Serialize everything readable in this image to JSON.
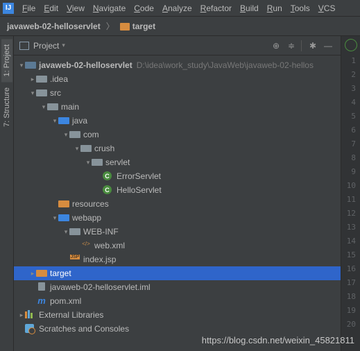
{
  "menu": {
    "items": [
      "File",
      "Edit",
      "View",
      "Navigate",
      "Code",
      "Analyze",
      "Refactor",
      "Build",
      "Run",
      "Tools",
      "VCS"
    ]
  },
  "breadcrumb": {
    "project": "javaweb-02-helloservlet",
    "target": "target"
  },
  "panel": {
    "title": "Project"
  },
  "sidebar": {
    "tabs": [
      {
        "label": "1: Project",
        "active": true
      },
      {
        "label": "7: Structure",
        "active": false
      }
    ]
  },
  "tree": [
    {
      "depth": 0,
      "arrow": "down",
      "icon": "folder-gblue",
      "label": "javaweb-02-helloservlet",
      "bold": true,
      "path": "D:\\idea\\work_study\\JavaWeb\\javaweb-02-hellos"
    },
    {
      "depth": 1,
      "arrow": "right",
      "icon": "folder",
      "label": ".idea"
    },
    {
      "depth": 1,
      "arrow": "down",
      "icon": "folder",
      "label": "src"
    },
    {
      "depth": 2,
      "arrow": "down",
      "icon": "folder",
      "label": "main"
    },
    {
      "depth": 3,
      "arrow": "down",
      "icon": "folder-blue",
      "label": "java"
    },
    {
      "depth": 4,
      "arrow": "down",
      "icon": "folder",
      "label": "com"
    },
    {
      "depth": 5,
      "arrow": "down",
      "icon": "folder",
      "label": "crush"
    },
    {
      "depth": 6,
      "arrow": "down",
      "icon": "folder",
      "label": "servlet"
    },
    {
      "depth": 7,
      "arrow": "",
      "icon": "class",
      "label": "ErrorServlet"
    },
    {
      "depth": 7,
      "arrow": "",
      "icon": "class",
      "label": "HelloServlet"
    },
    {
      "depth": 3,
      "arrow": "",
      "icon": "folder-orange",
      "label": "resources"
    },
    {
      "depth": 3,
      "arrow": "down",
      "icon": "folder-blue",
      "label": "webapp"
    },
    {
      "depth": 4,
      "arrow": "down",
      "icon": "folder",
      "label": "WEB-INF"
    },
    {
      "depth": 5,
      "arrow": "",
      "icon": "xml",
      "label": "web.xml"
    },
    {
      "depth": 4,
      "arrow": "",
      "icon": "jsp",
      "label": "index.jsp"
    },
    {
      "depth": 1,
      "arrow": "right",
      "icon": "folder-orange",
      "label": "target",
      "selected": true
    },
    {
      "depth": 1,
      "arrow": "",
      "icon": "file",
      "label": "javaweb-02-helloservlet.iml"
    },
    {
      "depth": 1,
      "arrow": "",
      "icon": "maven",
      "label": "pom.xml"
    },
    {
      "depth": 0,
      "arrow": "right",
      "icon": "lib",
      "label": "External Libraries"
    },
    {
      "depth": 0,
      "arrow": "",
      "icon": "scratch",
      "label": "Scratches and Consoles"
    }
  ],
  "gutter": {
    "lines": [
      1,
      2,
      3,
      4,
      5,
      6,
      7,
      8,
      9,
      10,
      11,
      12,
      13,
      14,
      15,
      16,
      17,
      18,
      19,
      20
    ]
  },
  "watermark": "https://blog.csdn.net/weixin_45821811"
}
